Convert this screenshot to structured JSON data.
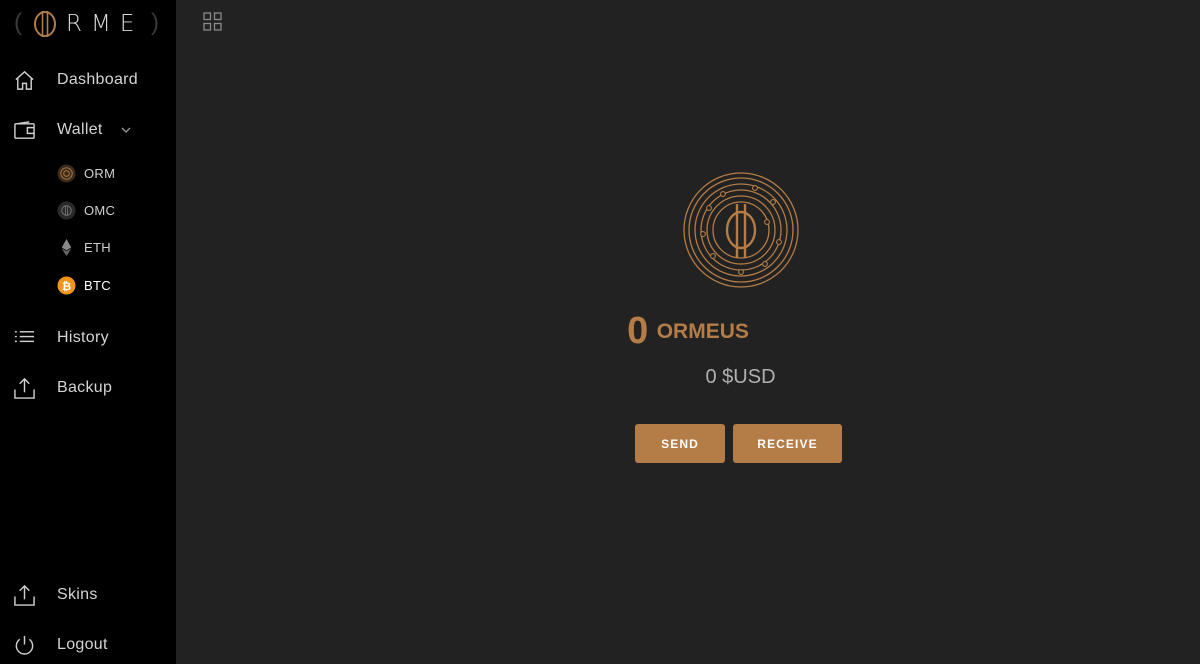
{
  "brand": {
    "logo_text": "RME",
    "accent_color": "#b47c46"
  },
  "sidebar": {
    "items": [
      {
        "label": "Dashboard",
        "icon": "home-icon"
      },
      {
        "label": "Wallet",
        "icon": "wallet-icon",
        "expanded": true
      },
      {
        "label": "History",
        "icon": "list-icon"
      },
      {
        "label": "Backup",
        "icon": "upload-icon"
      },
      {
        "label": "Skins",
        "icon": "upload-icon"
      },
      {
        "label": "Logout",
        "icon": "power-icon"
      }
    ],
    "wallet_subitems": [
      {
        "label": "ORM",
        "icon": "orm-coin-icon"
      },
      {
        "label": "OMC",
        "icon": "omc-coin-icon"
      },
      {
        "label": "ETH",
        "icon": "eth-icon"
      },
      {
        "label": "BTC",
        "icon": "btc-icon",
        "active": true
      }
    ]
  },
  "main": {
    "grid_icon": "grid-icon",
    "coin_icon": "ormeus-coin-icon",
    "balance": {
      "amount": "0",
      "unit": "ORMEUS"
    },
    "usd": "0 $USD",
    "send_label": "SEND",
    "receive_label": "RECEIVE"
  }
}
